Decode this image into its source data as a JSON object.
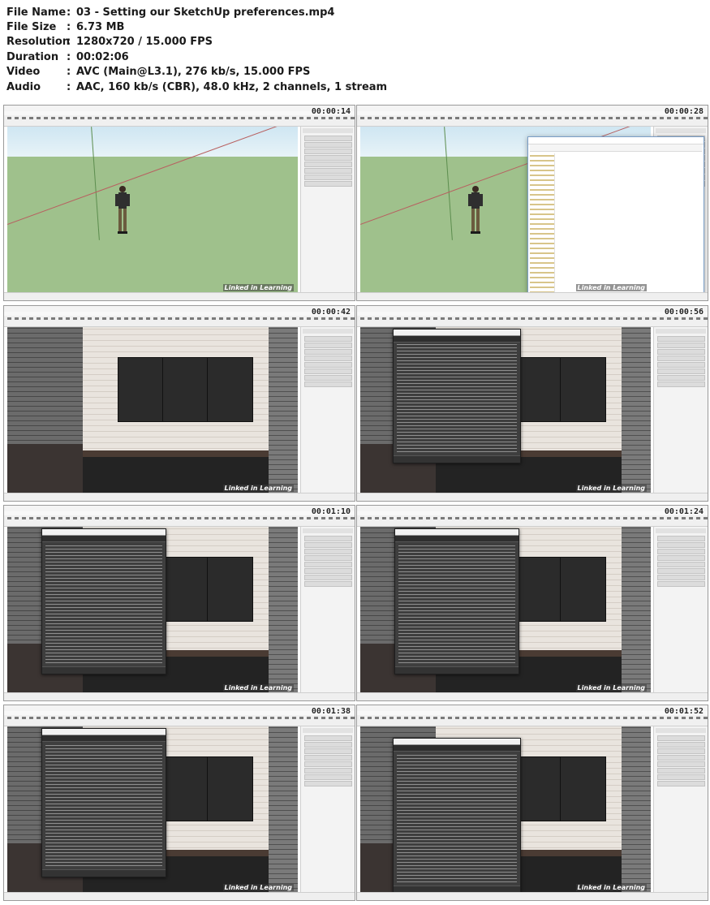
{
  "info": [
    {
      "key": "File Name",
      "value": "03 - Setting our SketchUp preferences.mp4"
    },
    {
      "key": "File Size",
      "value": "6.73 MB"
    },
    {
      "key": "Resolution",
      "value": "1280x720 / 15.000 FPS"
    },
    {
      "key": "Duration",
      "value": "00:02:06"
    },
    {
      "key": "Video",
      "value": "AVC (Main@L3.1), 276 kb/s, 15.000 FPS"
    },
    {
      "key": "Audio",
      "value": "AAC, 160 kb/s (CBR), 48.0 kHz, 2 channels, 1 stream"
    }
  ],
  "info_separator": ":",
  "frames": [
    {
      "timestamp": "00:00:14",
      "scene": "sketchup-grid"
    },
    {
      "timestamp": "00:00:28",
      "scene": "sketchup-grid-explorer"
    },
    {
      "timestamp": "00:00:42",
      "scene": "kitchen"
    },
    {
      "timestamp": "00:00:56",
      "scene": "kitchen-dialog"
    },
    {
      "timestamp": "00:01:10",
      "scene": "kitchen-dialog-left"
    },
    {
      "timestamp": "00:01:24",
      "scene": "kitchen-dialog-left"
    },
    {
      "timestamp": "00:01:38",
      "scene": "kitchen-dialog-left"
    },
    {
      "timestamp": "00:01:52",
      "scene": "kitchen-dialog-center"
    }
  ],
  "watermark": "Linked in Learning",
  "colors": {
    "sky": "#cfe6f2",
    "ground": "#9fc18c",
    "dialog_bg": "#3e3e3e",
    "cabinet": "#2b2b2b"
  }
}
